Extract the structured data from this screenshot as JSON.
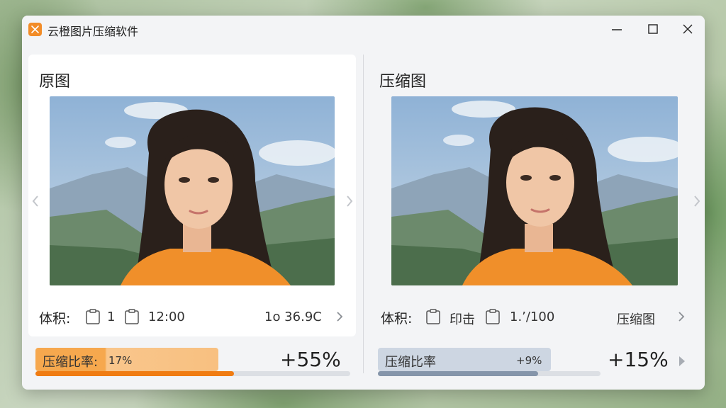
{
  "window": {
    "title": "云橙图片压缩软件",
    "accent": "#f28c28"
  },
  "icons": {
    "app": "app-logo-icon",
    "minimize": "minimize-icon",
    "maximize": "maximize-icon",
    "close": "close-icon",
    "clipboard": "clipboard-icon",
    "chevron": "chevron-right-icon"
  },
  "original": {
    "title": "原图",
    "size_label": "体积:",
    "value_a": "1",
    "value_b": "12:00",
    "value_right": "1o 36.9C",
    "ratio_label": "压缩比率:",
    "ratio_inner": "17%",
    "ratio_big": "+55%",
    "ratio_fraction": 0.63
  },
  "compressed": {
    "title": "压缩图",
    "size_label": "体积:",
    "value_a": "印击",
    "value_b": "1.’/100",
    "value_right": "压缩图",
    "ratio_label": "压缩比率",
    "ratio_inner": "+9%",
    "ratio_big": "+15%",
    "ratio_fraction": 0.72
  }
}
